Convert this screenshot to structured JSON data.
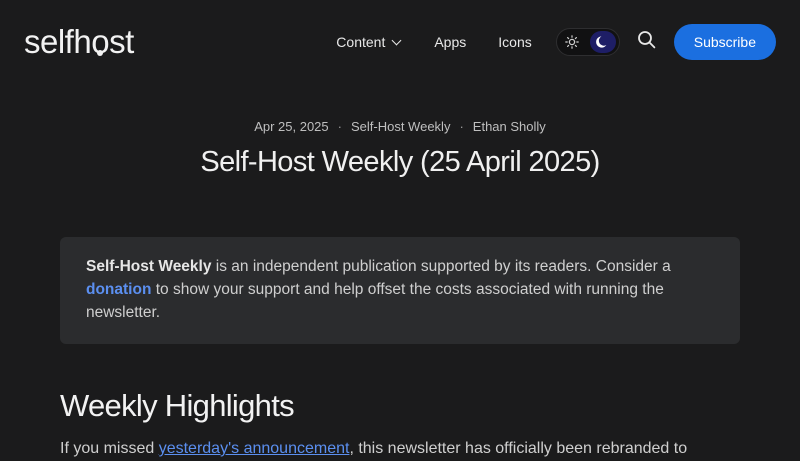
{
  "header": {
    "logo_left": "selfh",
    "logo_o": "o",
    "logo_right": "st",
    "nav": {
      "content_label": "Content",
      "apps_label": "Apps",
      "icons_label": "Icons"
    },
    "subscribe_label": "Subscribe"
  },
  "article": {
    "date": "Apr 25, 2025",
    "tag": "Self-Host Weekly",
    "author": "Ethan Sholly",
    "title": "Self-Host Weekly (25 April 2025)",
    "callout": {
      "bold_lead": "Self-Host Weekly",
      "text_1": " is an independent publication supported by its readers. Consider a ",
      "link": "donation",
      "text_2": " to show your support and help offset the costs associated with running the newsletter."
    },
    "section_heading": "Weekly Highlights",
    "paragraph": {
      "text_1": "If you missed ",
      "link": "yesterday's announcement",
      "text_2": ", this newsletter has officially been rebranded to"
    }
  },
  "colors": {
    "background": "#1b1b1c",
    "accent": "#1b6fe0",
    "link": "#5b8ff0",
    "callout_bg": "#2b2c2e"
  },
  "icons": {
    "chevron": "chevron-down-icon",
    "sun": "sun-icon",
    "moon": "moon-icon",
    "search": "search-icon"
  }
}
